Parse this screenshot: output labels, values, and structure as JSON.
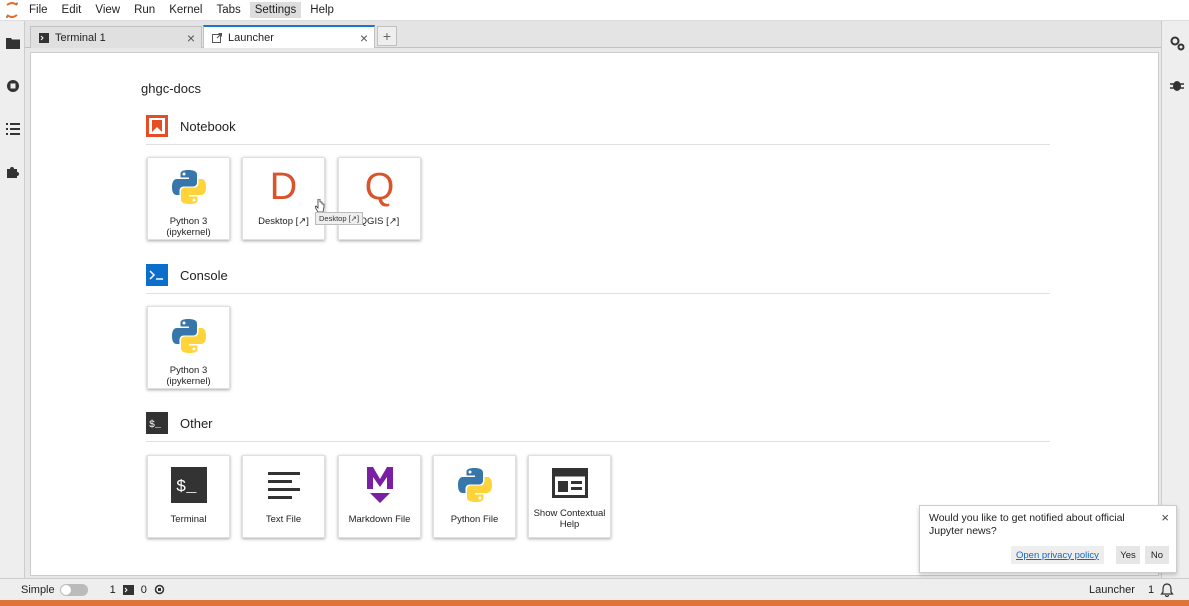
{
  "menubar": {
    "items": [
      "File",
      "Edit",
      "View",
      "Run",
      "Kernel",
      "Tabs",
      "Settings",
      "Help"
    ],
    "active": "Settings"
  },
  "tabs": [
    {
      "label": "Terminal 1",
      "icon": "terminal-icon",
      "active": false
    },
    {
      "label": "Launcher",
      "icon": "launcher-icon",
      "active": true
    }
  ],
  "add_tab_label": "+",
  "launcher": {
    "cwd": "ghgc-docs",
    "sections": [
      {
        "title": "Notebook",
        "icon": "notebook-icon",
        "cards": [
          {
            "label": "Python 3 (ipykernel)",
            "icon": "python-icon"
          },
          {
            "label": "Desktop [↗]",
            "icon": "desktop-letter-icon",
            "letter": "D"
          },
          {
            "label": "QGIS [↗]",
            "icon": "qgis-letter-icon",
            "letter": "Q"
          }
        ]
      },
      {
        "title": "Console",
        "icon": "console-icon",
        "cards": [
          {
            "label": "Python 3 (ipykernel)",
            "icon": "python-icon"
          }
        ]
      },
      {
        "title": "Other",
        "icon": "other-icon",
        "cards": [
          {
            "label": "Terminal",
            "icon": "terminal-icon"
          },
          {
            "label": "Text File",
            "icon": "text-file-icon"
          },
          {
            "label": "Markdown File",
            "icon": "markdown-icon"
          },
          {
            "label": "Python File",
            "icon": "python-icon"
          },
          {
            "label": "Show Contextual Help",
            "icon": "contextual-help-icon"
          }
        ]
      }
    ],
    "tooltip": "Desktop [↗]"
  },
  "notification": {
    "message": "Would you like to get notified about official Jupyter news?",
    "link": "Open privacy policy",
    "yes": "Yes",
    "no": "No",
    "close": "×"
  },
  "statusbar": {
    "mode": "Simple",
    "terminals": "1",
    "kernels": "0",
    "right_label": "Launcher",
    "right_count": "1"
  },
  "colors": {
    "accent": "#1976d2",
    "brand_orange": "#e0733a",
    "notebook_icon": "#e44d26",
    "console_icon": "#0b6ecb",
    "markdown": "#7b1fa2"
  }
}
